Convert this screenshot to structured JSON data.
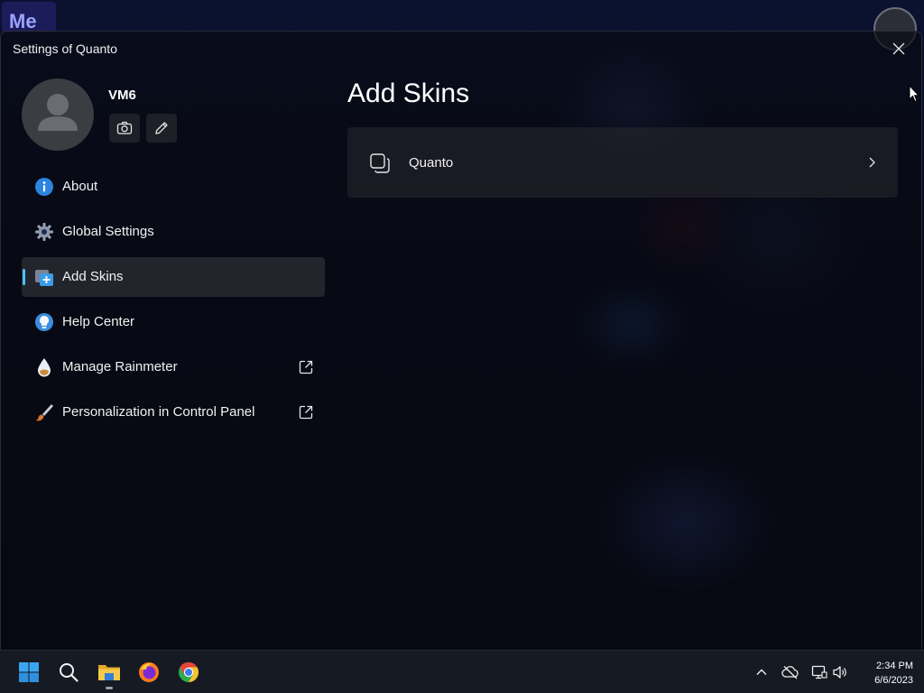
{
  "window": {
    "title": "Settings of Quanto"
  },
  "profile": {
    "name": "VM6"
  },
  "sidebar": {
    "items": [
      {
        "label": "About",
        "icon": "info-icon"
      },
      {
        "label": "Global Settings",
        "icon": "gear-icon"
      },
      {
        "label": "Add Skins",
        "icon": "add-skins-icon",
        "selected": true
      },
      {
        "label": "Help Center",
        "icon": "lightbulb-icon"
      },
      {
        "label": "Manage Rainmeter",
        "icon": "rainmeter-drop-icon",
        "external": true
      },
      {
        "label": "Personalization in Control Panel",
        "icon": "paintbrush-icon",
        "external": true
      }
    ]
  },
  "main": {
    "title": "Add Skins",
    "cards": [
      {
        "label": "Quanto",
        "icon": "skin-copy-icon"
      }
    ]
  },
  "taskbar": {
    "time": "2:34 PM",
    "date": "6/6/2023"
  },
  "colors": {
    "accent": "#4cc2ff",
    "window_bg": "#0a0c16",
    "card_bg": "#28282e",
    "taskbar_bg": "#161a23"
  }
}
